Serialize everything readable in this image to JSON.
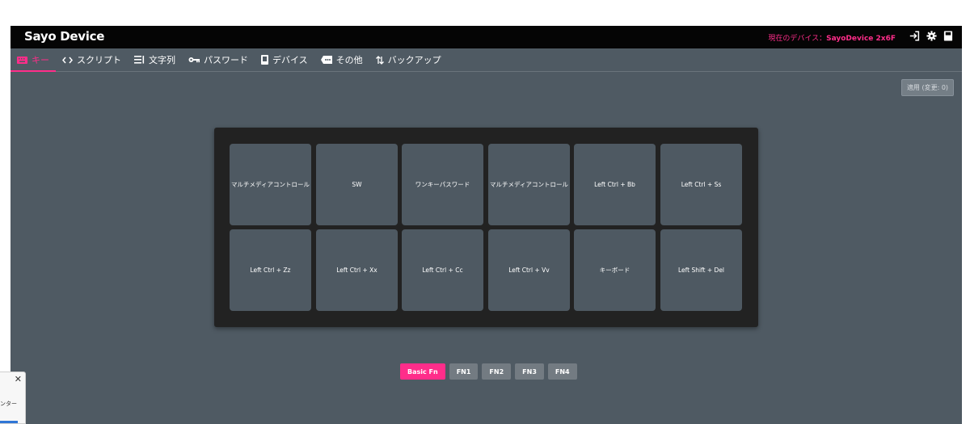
{
  "app": {
    "title": "Sayo Device",
    "device_label": "現在のデバイス：",
    "device_name": "SayoDevice 2x6F"
  },
  "title_icons": [
    "sign-in-icon",
    "gear-icon",
    "save-icon"
  ],
  "nav": {
    "items": [
      {
        "label": "キー",
        "icon": "keyboard-icon",
        "active": true
      },
      {
        "label": "スクリプト",
        "icon": "code-icon"
      },
      {
        "label": "文字列",
        "icon": "list-icon"
      },
      {
        "label": "パスワード",
        "icon": "key-icon"
      },
      {
        "label": "デバイス",
        "icon": "device-icon"
      },
      {
        "label": "その他",
        "icon": "more-icon"
      },
      {
        "label": "バックアップ",
        "icon": "swap-icon"
      }
    ]
  },
  "apply_button": "適用 (変更: 0)",
  "keys": [
    [
      "マルチメディアコントロール",
      "SW",
      "ワンキーパスワード",
      "マルチメディアコントロール",
      "Left Ctrl + Bb",
      "Left Ctrl + Ss"
    ],
    [
      "Left Ctrl + Zz",
      "Left Ctrl + Xx",
      "Left Ctrl + Cc",
      "Left Ctrl + Vv",
      "キーボード",
      "Left Shift + Del"
    ]
  ],
  "layers": {
    "items": [
      "Basic Fn",
      "FN1",
      "FN2",
      "FN3",
      "FN4"
    ],
    "active": "Basic Fn"
  },
  "overlay": {
    "close": "✕",
    "text": "ンター"
  },
  "colors": {
    "accent": "#ff2d8a",
    "background": "#4f5a63",
    "titlebar": "#050505",
    "panel": "#222222"
  }
}
